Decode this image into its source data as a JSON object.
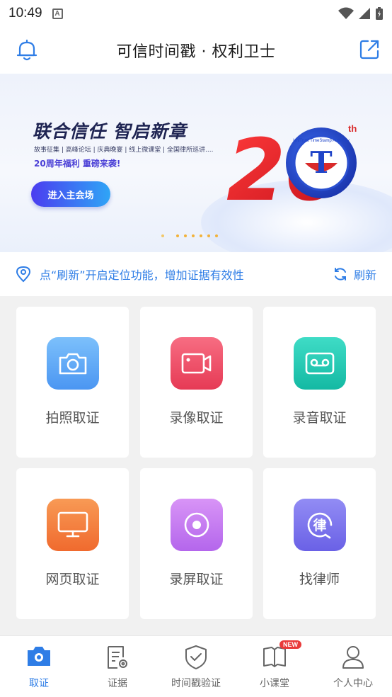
{
  "status_bar": {
    "time": "10:49",
    "notification_glyph": "A"
  },
  "header": {
    "title": "可信时间戳 · 权利卫士"
  },
  "banner": {
    "headline": "联合信任 智启新章",
    "subline": "故事征集 | 高峰论坛 | 庆典晚宴 | 线上微课堂 | 全国律所巡讲....",
    "promo": "20周年福利 重磅来袭!",
    "cta_label": "进入主会场",
    "logo_number": "20",
    "logo_suffix": "th",
    "seal_text": "UniTrust TimeStamp Authority",
    "slide_count": 7,
    "active_slide": 0
  },
  "location": {
    "text": "点“刷新”开启定位功能，增加证据有效性",
    "refresh_label": "刷新"
  },
  "features": [
    {
      "label": "拍照取证",
      "icon": "camera-icon",
      "color": "#5aa8f7"
    },
    {
      "label": "录像取证",
      "icon": "video-camera-icon",
      "color": "#f0506a"
    },
    {
      "label": "录音取证",
      "icon": "cassette-icon",
      "color": "#20cfb8"
    },
    {
      "label": "网页取证",
      "icon": "monitor-icon",
      "color": "#f47b3e"
    },
    {
      "label": "录屏取证",
      "icon": "screen-record-icon",
      "color": "#c77af0"
    },
    {
      "label": "找律师",
      "icon": "lawyer-icon",
      "color": "#7b74ec"
    }
  ],
  "tabbar": {
    "tabs": [
      {
        "label": "取证",
        "icon": "camera-icon",
        "active": true
      },
      {
        "label": "证据",
        "icon": "document-settings-icon",
        "active": false
      },
      {
        "label": "时间戳验证",
        "icon": "shield-check-icon",
        "active": false
      },
      {
        "label": "小课堂",
        "icon": "book-icon",
        "active": false,
        "badge": "NEW"
      },
      {
        "label": "个人中心",
        "icon": "user-icon",
        "active": false
      }
    ]
  },
  "colors": {
    "accent": "#2e7de6",
    "badge": "#e93a3a"
  }
}
